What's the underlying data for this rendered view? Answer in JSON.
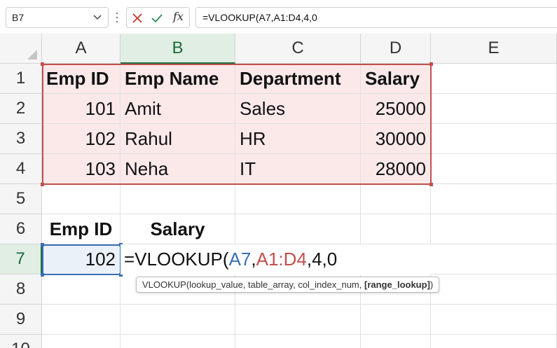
{
  "formula_bar": {
    "name_box": "B7",
    "cancel_icon": "close-icon",
    "enter_icon": "checkmark-icon",
    "fx_label": "fx",
    "formula": "=VLOOKUP(A7,A1:D4,4,0"
  },
  "columns": [
    "A",
    "B",
    "C",
    "D",
    "E"
  ],
  "selected_column": "B",
  "rows": [
    "1",
    "2",
    "3",
    "4",
    "5",
    "6",
    "7",
    "8",
    "9",
    "10"
  ],
  "selected_row": "7",
  "table": {
    "headers": [
      "Emp ID",
      "Emp Name",
      "Department",
      "Salary"
    ],
    "records": [
      [
        "101",
        "Amit",
        "Sales",
        "25000"
      ],
      [
        "102",
        "Rahul",
        "HR",
        "30000"
      ],
      [
        "103",
        "Neha",
        "IT",
        "28000"
      ]
    ]
  },
  "lookup": {
    "id_header": "Emp ID",
    "salary_header": "Salary",
    "id_value": "102"
  },
  "editing": {
    "prefix": "=VLOOKUP(",
    "ref1": "A7",
    "comma1": ",",
    "ref2": "A1:D4",
    "rest": ",4,0"
  },
  "tooltip": {
    "text": "VLOOKUP(lookup_value, table_array, col_index_num, ",
    "optional": "[range_lookup]",
    "close": ")"
  },
  "colors": {
    "table_fill": "#fbe9ea",
    "table_range": "#c0504d",
    "lookup_ref": "#3a6fb4",
    "selection": "#1e7145"
  }
}
